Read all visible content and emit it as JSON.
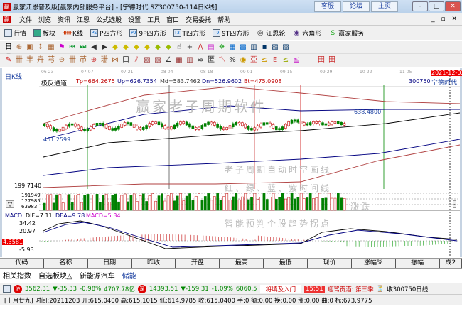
{
  "window": {
    "title": "赢家江恩普及版[赢家内部服务平台] - [宁德时代  SZ300750-114日K线]",
    "buttons": [
      "客服",
      "论坛",
      "主页"
    ]
  },
  "menu": [
    "文件",
    "浏览",
    "资讯",
    "江恩",
    "公式选股",
    "设置",
    "工具",
    "窗口",
    "交易委托",
    "帮助"
  ],
  "toolbar1": [
    "行情",
    "板块",
    "K线",
    "P四方形",
    "9P四方形",
    "T四方形",
    "9T四方形",
    "江恩轮",
    "六角形",
    "赢家服务"
  ],
  "chart": {
    "period": "日K线",
    "dates": [
      "06-23",
      "07-07",
      "07-21",
      "08-04",
      "08-18",
      "09-01",
      "09-15",
      "09-29",
      "10-22",
      "11-05",
      "11-19"
    ],
    "current_date": "2021-12-03",
    "indicator": "极反通道",
    "tp": "Tp=664.2675",
    "up": "Up=626.7354",
    "md": "Md=583.7462",
    "dn": "Dn=526.9602",
    "bt": "Bt=475.0908",
    "code": "300750",
    "name": "宁德时代",
    "price_high_label": "638.4800",
    "price_low_label": "451.2599",
    "axis_low": "199.7140",
    "vol_labels": [
      "191949",
      "127985",
      "63983"
    ],
    "macd": {
      "label": "MACD",
      "dif": "DIF=7.11",
      "dea": "DEA=9.78",
      "macd": "MACD=5.34",
      "ticks": [
        "34.42",
        "20.97",
        "-5.93"
      ],
      "current": "4.3581"
    },
    "watermark": "赢家老子周期软件",
    "promo": [
      "老子周期自动时空画线",
      "红、绿、蓝、紫时间线",
      "涨跌",
      "智能预判个股趋势拐点"
    ],
    "colors": {
      "up": "#c00000",
      "down": "#008000",
      "upper": "#b04040",
      "mid": "#000080"
    }
  },
  "table_headers": [
    "代码",
    "名称",
    "日期",
    "昨收",
    "开盘",
    "最高",
    "最低",
    "现价",
    "涨幅%",
    "振幅",
    "成2"
  ],
  "tabs": [
    "相关指数",
    "自选板块△",
    "新能源汽车",
    "储能"
  ],
  "status": {
    "sh": "3562.31",
    "sh_chg": "▼-35.33",
    "sh_pct": "-0.98%",
    "sh_amt": "4707.78亿",
    "sz": "14393.51",
    "sz_chg": "▼-159.31",
    "sz_pct": "-1.09%",
    "sz_amt": "6060.5",
    "news": "将填及入门",
    "time": "15:51",
    "ticker": "迎驾贡酒: 第三季",
    "task": "收300750日线"
  },
  "info": "[十月廿九] 时间:20211203 开:615.0400 高:615.1015 低:614.9785 收:615.0400 手:0 额:0.00 换:0.00 涨:0.00 曲:0 标:673.9775"
}
